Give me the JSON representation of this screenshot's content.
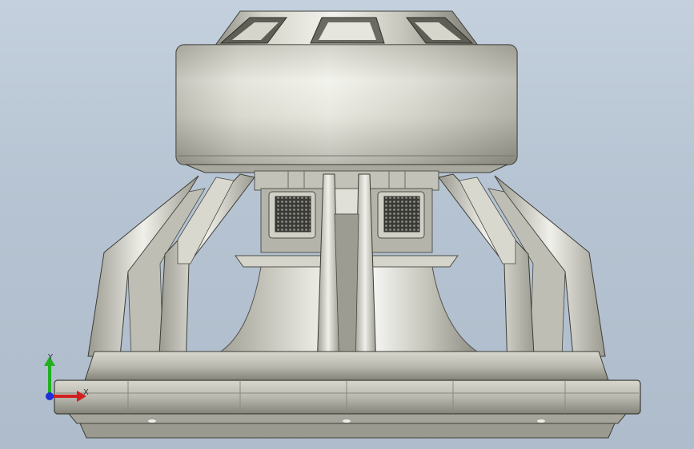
{
  "scene": {
    "subject": "subwoofer-speaker-3d-model",
    "view": "front-orthographic",
    "background_color": "#b8c6d4",
    "metal_color": "#c9c9bf"
  },
  "triad": {
    "x_label": "X",
    "y_label": "Y",
    "x_color": "#d22020",
    "y_color": "#20b020",
    "z_color": "#1f30d8"
  }
}
